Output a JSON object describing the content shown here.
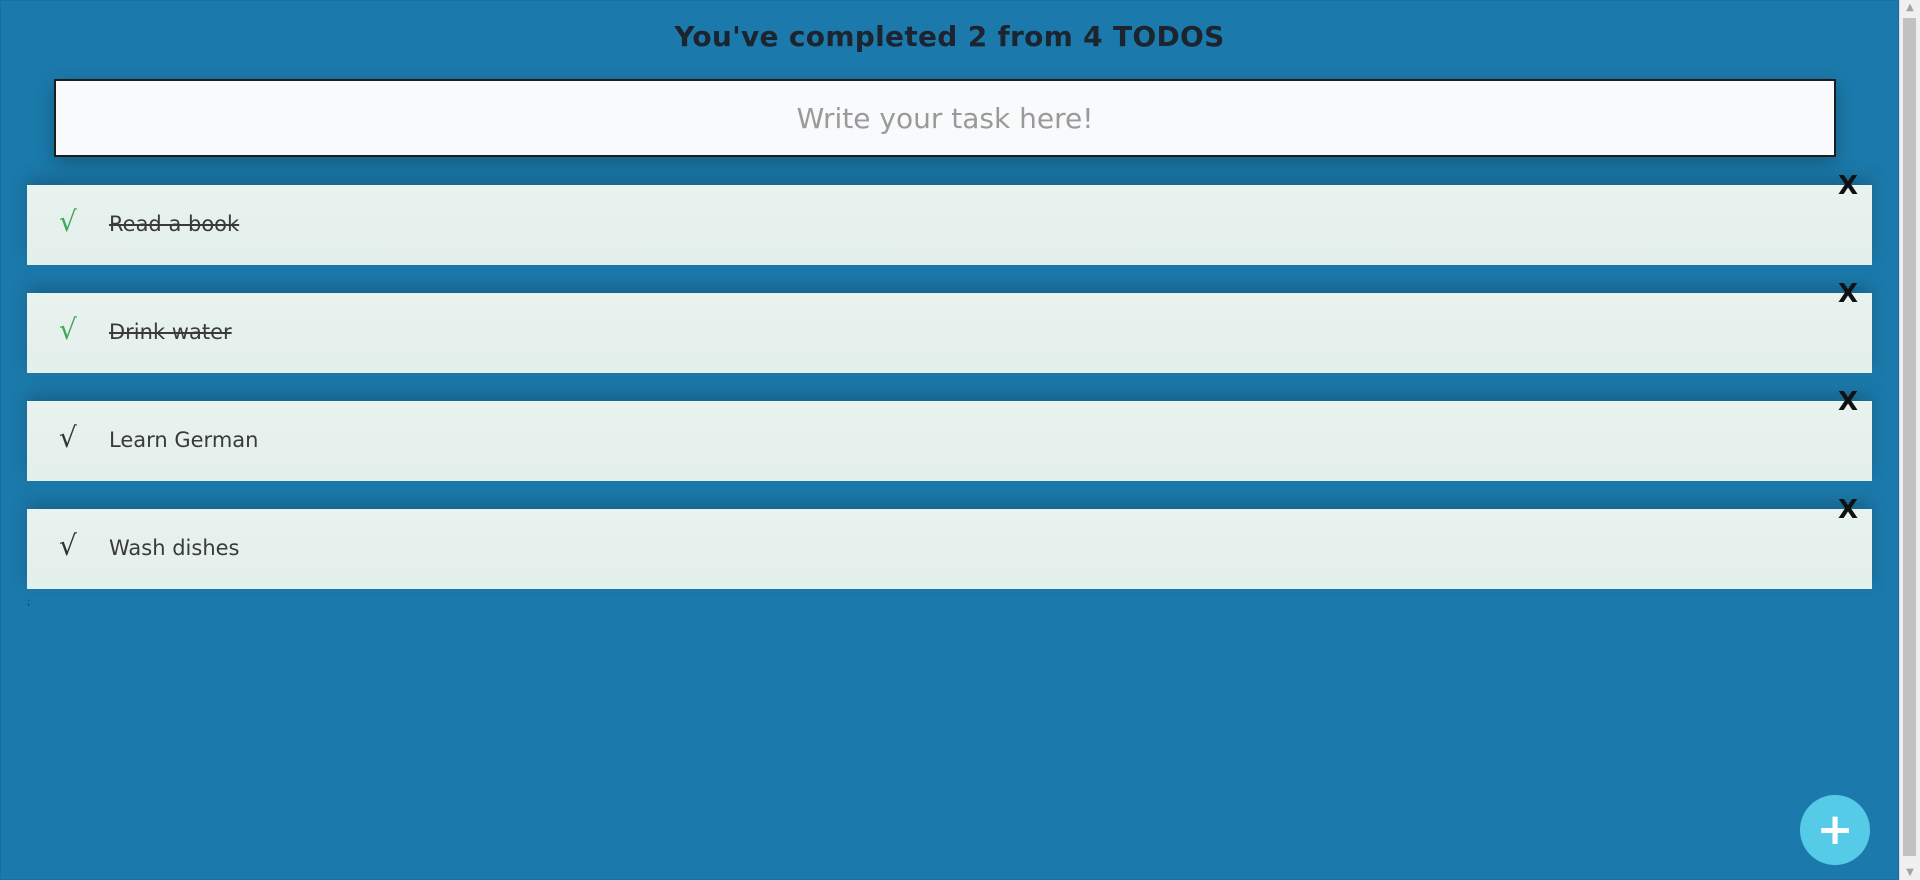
{
  "header": {
    "title": "You've completed 2 from 4 TODOS"
  },
  "input": {
    "placeholder": "Write your task here!",
    "value": ""
  },
  "todos": [
    {
      "text": "Read a book",
      "done": true,
      "check": "√",
      "delete": "X"
    },
    {
      "text": "Drink water",
      "done": true,
      "check": "√",
      "delete": "X"
    },
    {
      "text": "Learn German",
      "done": false,
      "check": "√",
      "delete": "X"
    },
    {
      "text": "Wash dishes",
      "done": false,
      "check": "√",
      "delete": "X"
    }
  ],
  "misc": {
    "mark": ";"
  },
  "fab": {
    "label": "+"
  },
  "scrollbar": {
    "up": "▲",
    "down": "▼"
  },
  "colors": {
    "background": "#1b7aab",
    "done_check": "#3fa65a",
    "fab": "#55cbe8"
  }
}
